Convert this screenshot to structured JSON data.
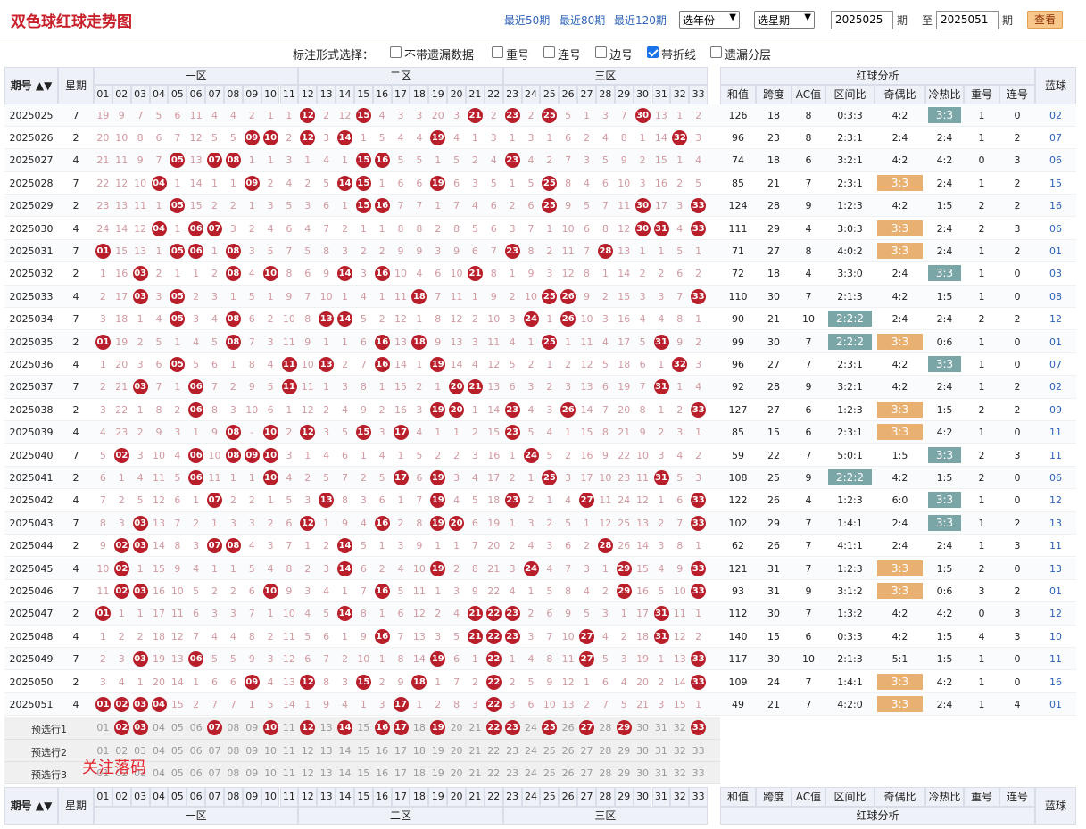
{
  "header": {
    "title": "双色球红球走势图",
    "links": [
      "最近50期",
      "最近80期",
      "最近120期"
    ],
    "year_select": "选年份",
    "week_select": "选星期",
    "from_issue": "2025025",
    "period1": "期",
    "to_label": "至",
    "to_issue": "2025051",
    "period2": "期",
    "query_button": "查看"
  },
  "options": {
    "label": "标注形式选择：",
    "items": [
      {
        "text": "不带遗漏数据",
        "checked": false
      },
      {
        "text": "重号",
        "checked": false
      },
      {
        "text": "连号",
        "checked": false
      },
      {
        "text": "边号",
        "checked": false
      },
      {
        "text": "带折线",
        "checked": true
      },
      {
        "text": "遗漏分层",
        "checked": false
      }
    ]
  },
  "table": {
    "col_issue": "期号",
    "sort_icon": "▲▼",
    "col_week": "星期",
    "zone1": "一区",
    "zone2": "二区",
    "zone3": "三区",
    "analysis": "红球分析",
    "col_blue": "蓝球",
    "analysis_cols": [
      "和值",
      "跨度",
      "AC值",
      "区间比",
      "奇偶比",
      "冷热比",
      "重号",
      "连号"
    ],
    "numbers": [
      "01",
      "02",
      "03",
      "04",
      "05",
      "06",
      "07",
      "08",
      "09",
      "10",
      "11",
      "12",
      "13",
      "14",
      "15",
      "16",
      "17",
      "18",
      "19",
      "20",
      "21",
      "22",
      "23",
      "24",
      "25",
      "26",
      "27",
      "28",
      "29",
      "30",
      "31",
      "32",
      "33"
    ],
    "rows": [
      {
        "issue": "2025025",
        "week": "7",
        "reds": [
          12,
          15,
          21,
          23,
          25,
          30
        ],
        "miss": "19 9 7 5 6 11 4 4 2 1 1 - 2 12 - 4 3 3 20 3 - 2 - 2 - 5 1 3 7 - 13 1 2",
        "stats": [
          "126",
          "18",
          "8",
          "0:3:3",
          "4:2",
          "3:3",
          "1",
          "0"
        ],
        "blue": "02"
      },
      {
        "issue": "2025026",
        "week": "2",
        "reds": [
          9,
          10,
          12,
          14,
          19,
          32
        ],
        "miss": "20 10 8 6 7 12 5 5 - - 2 - 3 - 1 5 4 4 - 4 1 3 1 3 1 6 2 4 8 1 14 - 3",
        "stats": [
          "96",
          "23",
          "8",
          "2:3:1",
          "2:4",
          "2:4",
          "1",
          "2"
        ],
        "blue": "07"
      },
      {
        "issue": "2025027",
        "week": "4",
        "reds": [
          5,
          7,
          8,
          15,
          16,
          23
        ],
        "miss": "21 11 9 7 - 13 - - 1 1 3 1 4 1 - - 5 5 1 5 2 4 - 4 2 7 3 5 9 2 15 1 4",
        "stats": [
          "74",
          "18",
          "6",
          "3:2:1",
          "4:2",
          "4:2",
          "0",
          "3"
        ],
        "blue": "06"
      },
      {
        "issue": "2025028",
        "week": "7",
        "reds": [
          4,
          9,
          14,
          15,
          19,
          25
        ],
        "miss": "22 12 10 - 1 14 1 1 - 2 4 2 5 - - 1 6 6 - 6 3 5 1 5 - 8 4 6 10 3 16 2 5",
        "stats": [
          "85",
          "21",
          "7",
          "2:3:1",
          "3:3",
          "2:4",
          "1",
          "2"
        ],
        "blue": "15"
      },
      {
        "issue": "2025029",
        "week": "2",
        "reds": [
          5,
          15,
          16,
          25,
          30,
          33
        ],
        "miss": "23 13 11 1 - 15 2 2 1 3 5 3 6 1 - - 7 7 1 7 4 6 2 6 - 9 5 7 11 - 17 3 -",
        "stats": [
          "124",
          "28",
          "9",
          "1:2:3",
          "4:2",
          "1:5",
          "2",
          "2"
        ],
        "blue": "16"
      },
      {
        "issue": "2025030",
        "week": "4",
        "reds": [
          4,
          6,
          7,
          30,
          31,
          33
        ],
        "miss": "24 14 12 - 1 - - 3 2 4 6 4 7 2 1 1 8 8 2 8 5 6 3 7 1 10 6 8 12 - - 4 -",
        "stats": [
          "111",
          "29",
          "4",
          "3:0:3",
          "3:3",
          "2:4",
          "2",
          "3"
        ],
        "blue": "06"
      },
      {
        "issue": "2025031",
        "week": "7",
        "reds": [
          1,
          5,
          6,
          8,
          23,
          28
        ],
        "miss": "- 15 13 1 - - 1 - 3 5 7 5 8 3 2 2 9 9 3 9 6 7 - 8 2 11 7 - 13 1 1 5 1",
        "stats": [
          "71",
          "27",
          "8",
          "4:0:2",
          "3:3",
          "2:4",
          "1",
          "2"
        ],
        "blue": "01"
      },
      {
        "issue": "2025032",
        "week": "2",
        "reds": [
          3,
          8,
          10,
          14,
          16,
          21
        ],
        "miss": "1 16 - 2 1 1 2 - 4 - 8 6 9 - 3 - 10 4 6 10 - 8 1 9 3 12 8 1 14 2 2 6 2",
        "stats": [
          "72",
          "18",
          "4",
          "3:3:0",
          "2:4",
          "3:3",
          "1",
          "0"
        ],
        "blue": "03"
      },
      {
        "issue": "2025033",
        "week": "4",
        "reds": [
          3,
          5,
          18,
          25,
          26,
          33
        ],
        "miss": "2 17 - 3 - 2 3 1 5 1 9 7 10 1 4 1 11 - 7 11 1 9 2 10 - - 9 2 15 3 3 7 -",
        "stats": [
          "110",
          "30",
          "7",
          "2:1:3",
          "4:2",
          "1:5",
          "1",
          "0"
        ],
        "blue": "08"
      },
      {
        "issue": "2025034",
        "week": "7",
        "reds": [
          5,
          8,
          13,
          14,
          24,
          26
        ],
        "miss": "3 18 1 4 - 3 4 - 6 2 10 8 - - 5 2 12 1 8 12 2 10 3 - 1 - 10 3 16 4 4 8 1",
        "stats": [
          "90",
          "21",
          "10",
          "2:2:2",
          "2:4",
          "2:4",
          "2",
          "2"
        ],
        "blue": "12"
      },
      {
        "issue": "2025035",
        "week": "2",
        "reds": [
          1,
          8,
          16,
          18,
          25,
          31
        ],
        "miss": "- 19 2 5 1 4 5 - 7 3 11 9 1 1 6 - 13 - 9 13 3 11 4 1 - 1 11 4 17 5 - 9 2",
        "stats": [
          "99",
          "30",
          "7",
          "2:2:2",
          "3:3",
          "0:6",
          "1",
          "0"
        ],
        "blue": "01"
      },
      {
        "issue": "2025036",
        "week": "4",
        "reds": [
          5,
          11,
          13,
          16,
          19,
          32
        ],
        "miss": "1 20 3 6 - 5 6 1 8 4 - 10 - 2 7 - 14 1 - 14 4 12 5 2 1 2 12 5 18 6 1 - 3",
        "stats": [
          "96",
          "27",
          "7",
          "2:3:1",
          "4:2",
          "3:3",
          "1",
          "0"
        ],
        "blue": "07"
      },
      {
        "issue": "2025037",
        "week": "7",
        "reds": [
          3,
          6,
          11,
          20,
          21,
          31
        ],
        "miss": "2 21 - 7 1 - 7 2 9 5 - 11 1 3 8 1 15 2 1 - - 13 6 3 2 3 13 6 19 7 - 1 4",
        "stats": [
          "92",
          "28",
          "9",
          "3:2:1",
          "4:2",
          "2:4",
          "1",
          "2"
        ],
        "blue": "02"
      },
      {
        "issue": "2025038",
        "week": "2",
        "reds": [
          6,
          19,
          20,
          23,
          26,
          33
        ],
        "miss": "3 22 1 8 2 - 8 3 10 6 1 12 2 4 9 2 16 3 - - 1 14 - 4 3 - 14 7 20 8 1 2 -",
        "stats": [
          "127",
          "27",
          "6",
          "1:2:3",
          "3:3",
          "1:5",
          "2",
          "2"
        ],
        "blue": "09"
      },
      {
        "issue": "2025039",
        "week": "4",
        "reds": [
          8,
          10,
          12,
          15,
          17,
          23
        ],
        "miss": "4 23 2 9 3 1 9 - - - 2 - 3 5 - 3 - 4 1 1 2 15 - 5 4 1 15 8 21 9 2 3 1",
        "stats": [
          "85",
          "15",
          "6",
          "2:3:1",
          "3:3",
          "4:2",
          "1",
          "0"
        ],
        "blue": "11"
      },
      {
        "issue": "2025040",
        "week": "7",
        "reds": [
          2,
          6,
          8,
          9,
          10,
          24
        ],
        "miss": "5 - 3 10 4 - 10 - - - 3 1 4 6 1 4 1 5 2 2 3 16 1 - 5 2 16 9 22 10 3 4 2",
        "stats": [
          "59",
          "22",
          "7",
          "5:0:1",
          "1:5",
          "3:3",
          "2",
          "3"
        ],
        "blue": "11"
      },
      {
        "issue": "2025041",
        "week": "2",
        "reds": [
          6,
          10,
          17,
          19,
          25,
          31
        ],
        "miss": "6 1 4 11 5 - 11 1 1 - 4 2 5 7 2 5 - 6 - 3 4 17 2 1 - 3 17 10 23 11 - 5 3",
        "stats": [
          "108",
          "25",
          "9",
          "2:2:2",
          "4:2",
          "1:5",
          "2",
          "0"
        ],
        "blue": "06"
      },
      {
        "issue": "2025042",
        "week": "4",
        "reds": [
          7,
          13,
          19,
          23,
          27,
          33
        ],
        "miss": "7 2 5 12 6 1 - 2 2 1 5 3 - 8 3 6 1 7 - 4 5 18 - 2 1 4 - 11 24 12 1 6 -",
        "stats": [
          "122",
          "26",
          "4",
          "1:2:3",
          "6:0",
          "3:3",
          "1",
          "0"
        ],
        "blue": "12"
      },
      {
        "issue": "2025043",
        "week": "7",
        "reds": [
          3,
          12,
          16,
          19,
          20,
          33
        ],
        "miss": "8 3 - 13 7 2 1 3 3 2 6 - 1 9 4 - 2 8 - - 6 19 1 3 2 5 1 12 25 13 2 7 -",
        "stats": [
          "102",
          "29",
          "7",
          "1:4:1",
          "2:4",
          "3:3",
          "1",
          "2"
        ],
        "blue": "13"
      },
      {
        "issue": "2025044",
        "week": "2",
        "reds": [
          2,
          3,
          7,
          8,
          14,
          28
        ],
        "miss": "9 - - 14 8 3 - - 4 3 7 1 2 - 5 1 3 9 1 1 7 20 2 4 3 6 2 - 26 14 3 8 1",
        "stats": [
          "62",
          "26",
          "7",
          "4:1:1",
          "2:4",
          "2:4",
          "1",
          "3"
        ],
        "blue": "11"
      },
      {
        "issue": "2025045",
        "week": "4",
        "reds": [
          2,
          14,
          19,
          24,
          29,
          33
        ],
        "miss": "10 - 1 15 9 4 1 1 5 4 8 2 3 - 6 2 4 10 - 2 8 21 3 - 4 7 3 1 - 15 4 9 -",
        "stats": [
          "121",
          "31",
          "7",
          "1:2:3",
          "3:3",
          "1:5",
          "2",
          "0"
        ],
        "blue": "13"
      },
      {
        "issue": "2025046",
        "week": "7",
        "reds": [
          2,
          3,
          10,
          16,
          29,
          33
        ],
        "miss": "11 - - 16 10 5 2 2 6 - 9 3 4 1 7 - 5 11 1 3 9 22 4 1 5 8 4 2 - 16 5 10 -",
        "stats": [
          "93",
          "31",
          "9",
          "3:1:2",
          "3:3",
          "0:6",
          "3",
          "2"
        ],
        "blue": "01"
      },
      {
        "issue": "2025047",
        "week": "2",
        "reds": [
          1,
          14,
          21,
          22,
          23,
          31
        ],
        "miss": "- 1 1 17 11 6 3 3 7 1 10 4 5 - 8 1 6 12 2 4 - - - 2 6 9 5 3 1 17 - 11 1",
        "stats": [
          "112",
          "30",
          "7",
          "1:3:2",
          "4:2",
          "4:2",
          "0",
          "3"
        ],
        "blue": "12"
      },
      {
        "issue": "2025048",
        "week": "4",
        "reds": [
          16,
          21,
          22,
          23,
          27,
          31
        ],
        "miss": "1 2 2 18 12 7 4 4 8 2 11 5 6 1 9 - 7 13 3 5 - - - 3 7 10 - 4 2 18 - 12 2",
        "stats": [
          "140",
          "15",
          "6",
          "0:3:3",
          "4:2",
          "1:5",
          "4",
          "3"
        ],
        "blue": "10"
      },
      {
        "issue": "2025049",
        "week": "7",
        "reds": [
          3,
          6,
          19,
          22,
          27,
          33
        ],
        "miss": "2 3 - 19 13 - 5 5 9 3 12 6 7 2 10 1 8 14 - 6 1 - 1 4 8 11 - 5 3 19 1 13 -",
        "stats": [
          "117",
          "30",
          "10",
          "2:1:3",
          "5:1",
          "1:5",
          "1",
          "0"
        ],
        "blue": "11"
      },
      {
        "issue": "2025050",
        "week": "2",
        "reds": [
          9,
          12,
          15,
          18,
          22,
          33
        ],
        "miss": "3 4 1 20 14 1 6 6 - 4 13 - 8 3 - 2 9 - 1 7 2 - 2 5 9 12 1 6 4 20 2 14 -",
        "stats": [
          "109",
          "24",
          "7",
          "1:4:1",
          "3:3",
          "4:2",
          "1",
          "0"
        ],
        "blue": "16"
      },
      {
        "issue": "2025051",
        "week": "4",
        "reds": [
          1,
          2,
          3,
          4,
          17,
          22
        ],
        "miss": "- - - - 15 2 7 7 1 5 14 1 9 4 1 3 - 1 2 8 3 - 3 6 10 13 2 7 5 21 3 15 1",
        "stats": [
          "49",
          "21",
          "7",
          "4:2:0",
          "3:3",
          "2:4",
          "1",
          "4"
        ],
        "blue": "01"
      }
    ],
    "pre_rows": [
      {
        "label": "预选行1",
        "picks": [
          2,
          3,
          7,
          10,
          12,
          14,
          16,
          17,
          19,
          22,
          23,
          25,
          27,
          29,
          33
        ]
      },
      {
        "label": "预选行2",
        "picks": []
      },
      {
        "label": "预选行3",
        "picks": []
      }
    ],
    "note": "关注落码"
  },
  "colors": {
    "ball": "#b81f2b",
    "header_bg": "#eef1f7",
    "title": "#c8212b",
    "link": "#2d62b8",
    "badge_teal": "#7ba6a8",
    "badge_orange": "#e8b071"
  }
}
